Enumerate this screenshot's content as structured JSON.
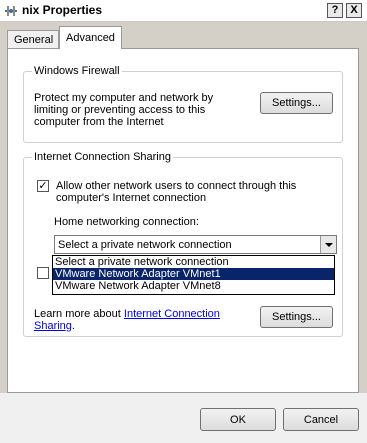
{
  "window": {
    "title": "nix Properties",
    "help_button": "?",
    "close_button": "X"
  },
  "tabs": [
    {
      "label": "General",
      "active": false
    },
    {
      "label": "Advanced",
      "active": true
    }
  ],
  "firewall": {
    "legend": "Windows Firewall",
    "description": "Protect my computer and network by limiting or preventing access to this computer from the Internet",
    "settings_label": "Settings..."
  },
  "ics": {
    "legend": "Internet Connection Sharing",
    "allow_checked": true,
    "allow_label": "Allow other network users to connect through this computer's Internet connection",
    "home_label": "Home networking connection:",
    "combo_value": "Select a private network connection",
    "dropdown_options": [
      "Select a private network connection",
      "VMware Network Adapter VMnet1",
      "VMware Network Adapter VMnet8"
    ],
    "dropdown_selected_index": 1,
    "second_checkbox_checked": false,
    "learn_more_prefix": "Learn more about",
    "learn_more_link": "Internet Connection Sharing",
    "learn_more_suffix": ".",
    "settings_label": "Settings..."
  },
  "footer": {
    "ok_label": "OK",
    "cancel_label": "Cancel"
  }
}
